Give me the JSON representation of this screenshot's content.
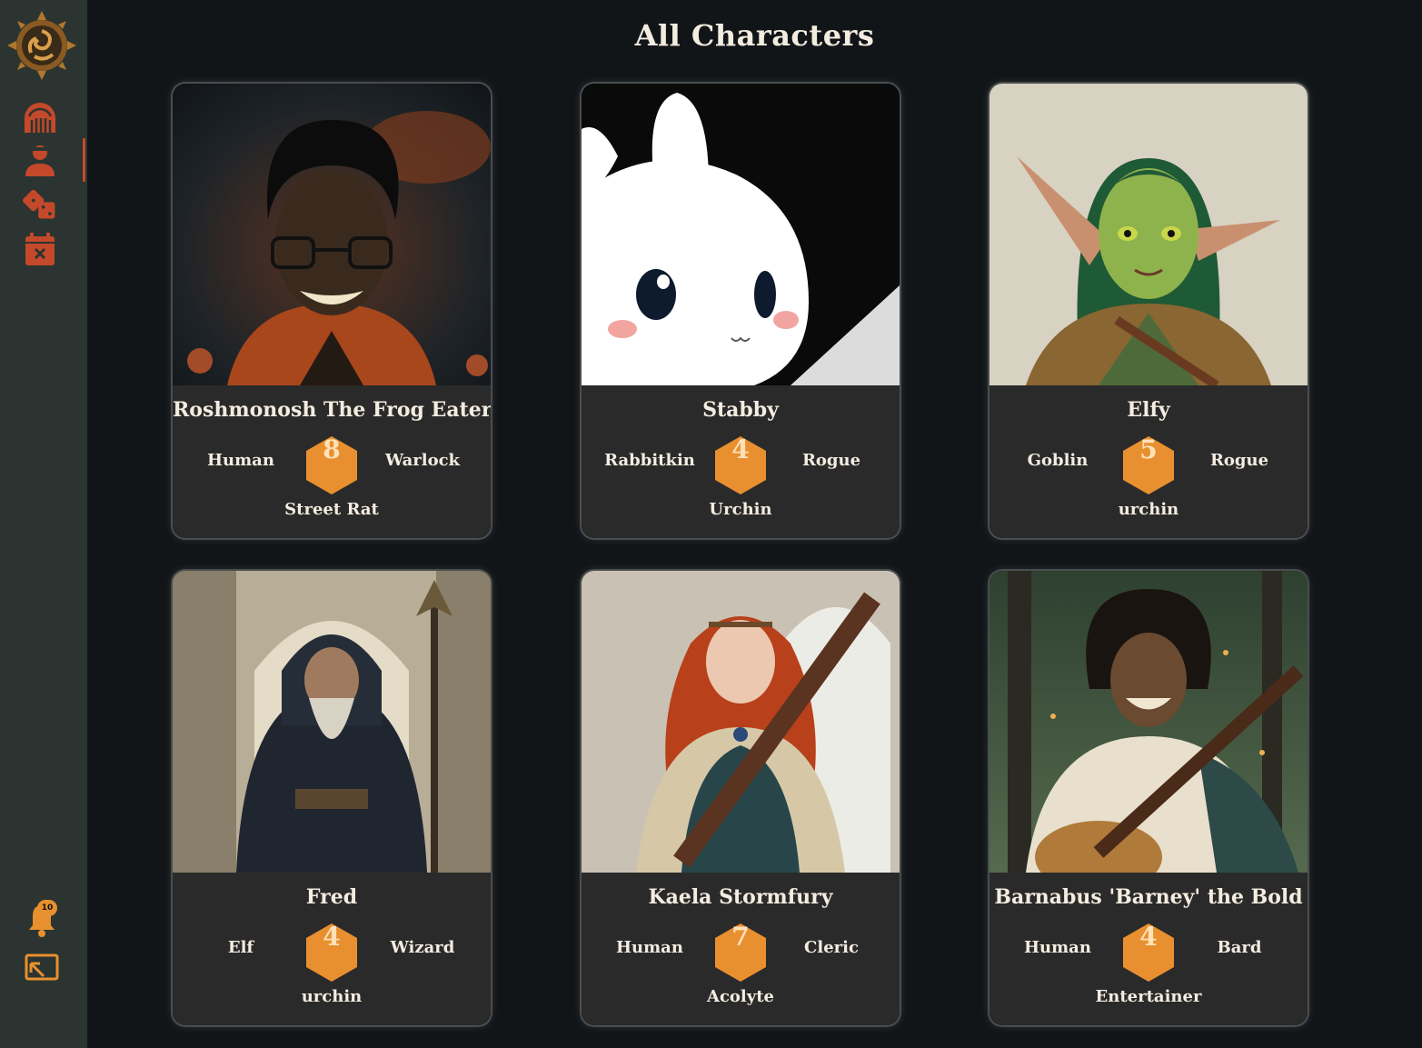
{
  "page": {
    "title": "All Characters"
  },
  "sidebar": {
    "notification_count": "10",
    "icons": [
      "campfire-icon",
      "character-icon",
      "dice-icon",
      "calendar-icon"
    ],
    "accent": "#c4492a"
  },
  "colors": {
    "background": "#111518",
    "sidebar": "#2b3430",
    "card_info": "#2b2a2a",
    "level_hex": "#e8902f"
  },
  "characters": [
    {
      "name": "Roshmonosh The Frog Eater",
      "race": "Human",
      "level": "8",
      "class": "Warlock",
      "background": "Street Rat"
    },
    {
      "name": "Stabby",
      "race": "Rabbitkin",
      "level": "4",
      "class": "Rogue",
      "background": "Urchin"
    },
    {
      "name": "Elfy",
      "race": "Goblin",
      "level": "5",
      "class": "Rogue",
      "background": "urchin"
    },
    {
      "name": "Fred",
      "race": "Elf",
      "level": "4",
      "class": "Wizard",
      "background": "urchin"
    },
    {
      "name": "Kaela Stormfury",
      "race": "Human",
      "level": "7",
      "class": "Cleric",
      "background": "Acolyte"
    },
    {
      "name": "Barnabus 'Barney' the Bold",
      "race": "Human",
      "level": "4",
      "class": "Bard",
      "background": "Entertainer"
    }
  ]
}
